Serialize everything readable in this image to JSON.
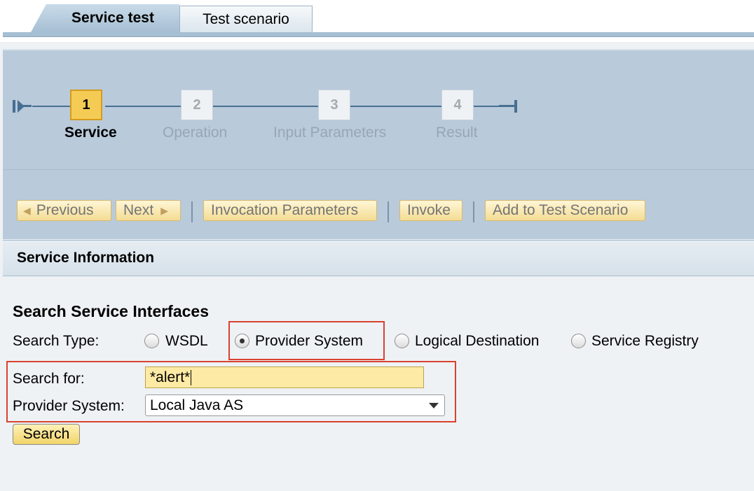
{
  "tabs": [
    {
      "label": "Service test",
      "active": true
    },
    {
      "label": "Test scenario",
      "active": false
    }
  ],
  "roadmap": {
    "current_step": 1,
    "steps": [
      {
        "number": "1",
        "label": "Service"
      },
      {
        "number": "2",
        "label": "Operation"
      },
      {
        "number": "3",
        "label": "Input Parameters"
      },
      {
        "number": "4",
        "label": "Result"
      }
    ]
  },
  "toolbar": {
    "previous_label": "Previous",
    "next_label": "Next",
    "invocation_label": "Invocation Parameters",
    "invoke_label": "Invoke",
    "add_scenario_label": "Add to Test Scenario"
  },
  "section": {
    "title": "Service Information"
  },
  "form": {
    "title": "Search Service Interfaces",
    "search_type_label": "Search Type:",
    "search_types": [
      {
        "label": "WSDL",
        "checked": false
      },
      {
        "label": "Provider System",
        "checked": true
      },
      {
        "label": "Logical Destination",
        "checked": false
      },
      {
        "label": "Service Registry",
        "checked": false
      }
    ],
    "search_for_label": "Search for:",
    "search_for_value": "*alert*",
    "provider_system_label": "Provider System:",
    "provider_system_value": "Local Java AS",
    "search_button_label": "Search"
  },
  "colors": {
    "highlight_red": "#d9412f",
    "active_step": "#f4cc55",
    "panel_blue": "#b9cadb"
  }
}
